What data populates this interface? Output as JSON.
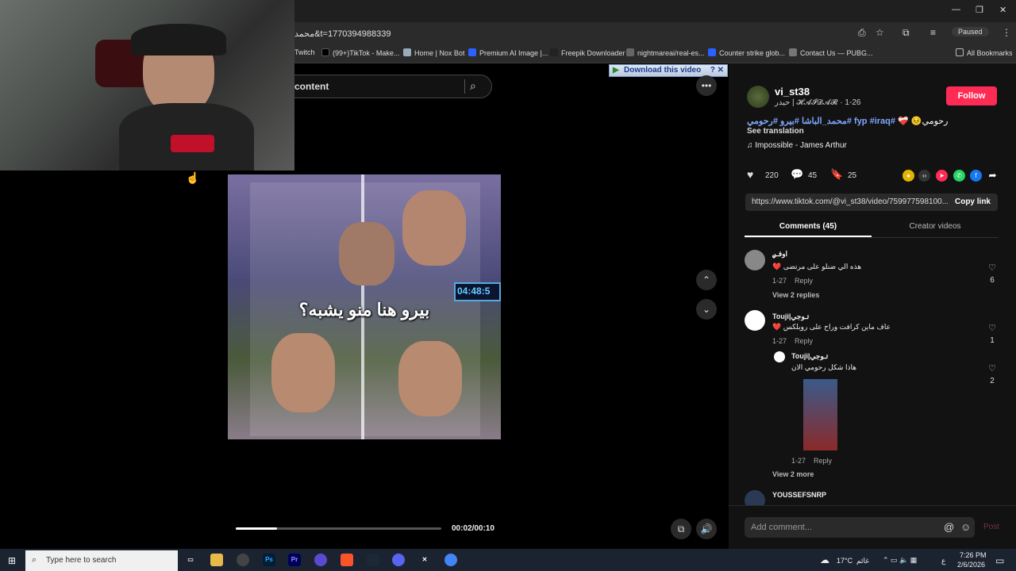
{
  "browser": {
    "url": "محمد&t=1770394988339",
    "profile_status": "Paused",
    "bookmarks": [
      "Twitch",
      "(99+)TikTok - Make...",
      "Home | Nox Bot",
      "Premium AI Image |...",
      "Freepik Downloader",
      "nightmareai/real-es...",
      "Counter strike glob...",
      "Contact Us — PUBG..."
    ],
    "all_bookmarks": "All Bookmarks"
  },
  "tiktok": {
    "search_placeholder": "content",
    "download_bar": "Download this video",
    "video": {
      "caption": "بيرو هنا منو يشبه؟",
      "overlay_time": "04:48:5",
      "time": "00:02/00:10",
      "progress": 0.2
    },
    "post": {
      "username": "vi_st38",
      "subline": "حيدر | 𝓗𝓐𝓘𝓓𝓐𝓡 · 1-26",
      "follow": "Follow",
      "caption_plain": "رحومي😣 ❤️‍🩹",
      "caption_tags": "#fyp #iraq #محمد_الباشا #بيرو #رحومي",
      "see_translation": "See translation",
      "music": "Impossible - James Arthur",
      "likes": "220",
      "comments": "45",
      "saves": "25",
      "link": "https://www.tiktok.com/@vi_st38/video/759977598100...",
      "copy_link": "Copy link"
    },
    "tabs": {
      "comments": "Comments (45)",
      "creator": "Creator videos"
    },
    "comments": [
      {
        "name": "اوفـࢪ",
        "text": "هذه الي ضنلو على مرتضى ❤️",
        "date": "1-27",
        "reply": "Reply",
        "likes": "6",
        "view": "View 2 replies"
      },
      {
        "name": "Touji|تـوجي",
        "text": "عاف ماين كرافت وراح على روبلكس ❤️",
        "date": "1-27",
        "reply": "Reply",
        "likes": "1"
      },
      {
        "name": "Touji|تـوجي",
        "text": "هاذا شكل رحومي الان",
        "date": "1-27",
        "reply": "Reply",
        "likes": "2",
        "view": "View 2 more"
      },
      {
        "name": "YOUSSEFSNRP",
        "text": ""
      }
    ],
    "comment_placeholder": "Add comment...",
    "post_button": "Post"
  },
  "taskbar": {
    "search": "Type here to search",
    "weather": "17°C",
    "weather_label": "غائم",
    "time": "7:26 PM",
    "date": "2/6/2026",
    "lang": "ع"
  }
}
